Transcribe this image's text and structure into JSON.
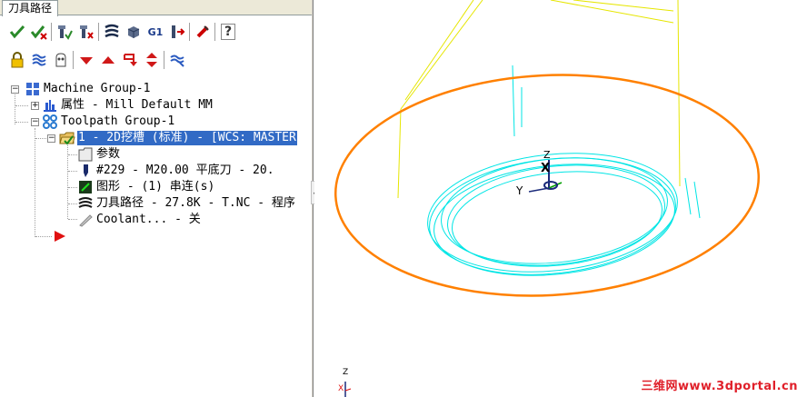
{
  "panel": {
    "tab_label": "刀具路径"
  },
  "toolbar1": [
    "select-all-ops-icon",
    "regenerate-icon",
    "select-dirty-icon",
    "regen-dirty-icon",
    "backplot-icon",
    "verify-icon",
    "post-g1-icon",
    "move-insert-icon",
    "highfeed-icon",
    "help-icon"
  ],
  "toolbar2": [
    "lock-icon",
    "toggle-display-icon",
    "toggle-post-icon",
    "move-down-icon",
    "move-up-icon",
    "insert-after-icon",
    "insert-arrow-icon",
    "scroll-view-icon"
  ],
  "toolbar_texts": {
    "g1": "G1",
    "help": "?"
  },
  "tree": {
    "machine_group": "Machine Group-1",
    "properties": "属性 - Mill Default MM",
    "toolpath_group": "Toolpath Group-1",
    "operation": "1 - 2D挖槽 (标准) - [WCS: MASTER",
    "parameters": "参数",
    "tool": "#229 - M20.00 平底刀 -     20.",
    "geometry": "图形 - (1) 串连(s)",
    "toolpath": "刀具路径 - 27.8K - T.NC - 程序",
    "coolant": "Coolant... - 关"
  },
  "viewport": {
    "axis_z": "Z",
    "axis_x": "X",
    "axis_y": "Y",
    "mini_axis_z": "Z",
    "mini_axis_x": "X",
    "watermark": "三维网www.3dportal.cn"
  },
  "colors": {
    "selection": "#316ac5",
    "toolpath": "#00e5e5",
    "stock_ring": "#ff8000",
    "tool_outline": "#e6e600",
    "watermark": "#e0202a"
  }
}
